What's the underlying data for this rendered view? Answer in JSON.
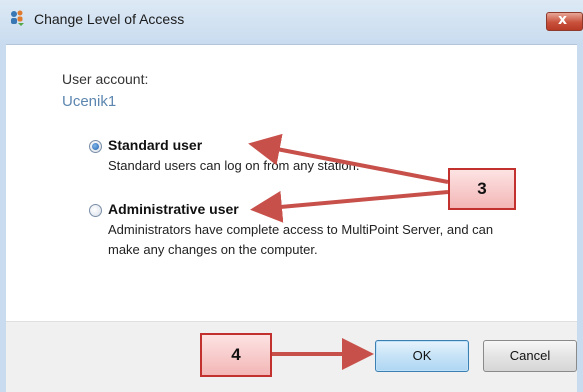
{
  "window": {
    "title": "Change Level of Access",
    "close_glyph": "x"
  },
  "account": {
    "label": "User account:",
    "name": "Ucenik1"
  },
  "options": [
    {
      "title": "Standard user",
      "description": "Standard users can log on from any station.",
      "selected": true
    },
    {
      "title": "Administrative user",
      "description_line1": "Administrators have complete access to MultiPoint Server, and can",
      "description_line2": "make any changes on the computer.",
      "selected": false
    }
  ],
  "callouts": {
    "step3": "3",
    "step4": "4"
  },
  "buttons": {
    "ok": "OK",
    "cancel": "Cancel"
  },
  "colors": {
    "annotation_arrow": "#c8504a",
    "callout_border": "#c2312d",
    "account_name": "#5c86b0"
  },
  "icons": {
    "title_icon": "people-access-icon",
    "close_icon": "close-icon"
  }
}
